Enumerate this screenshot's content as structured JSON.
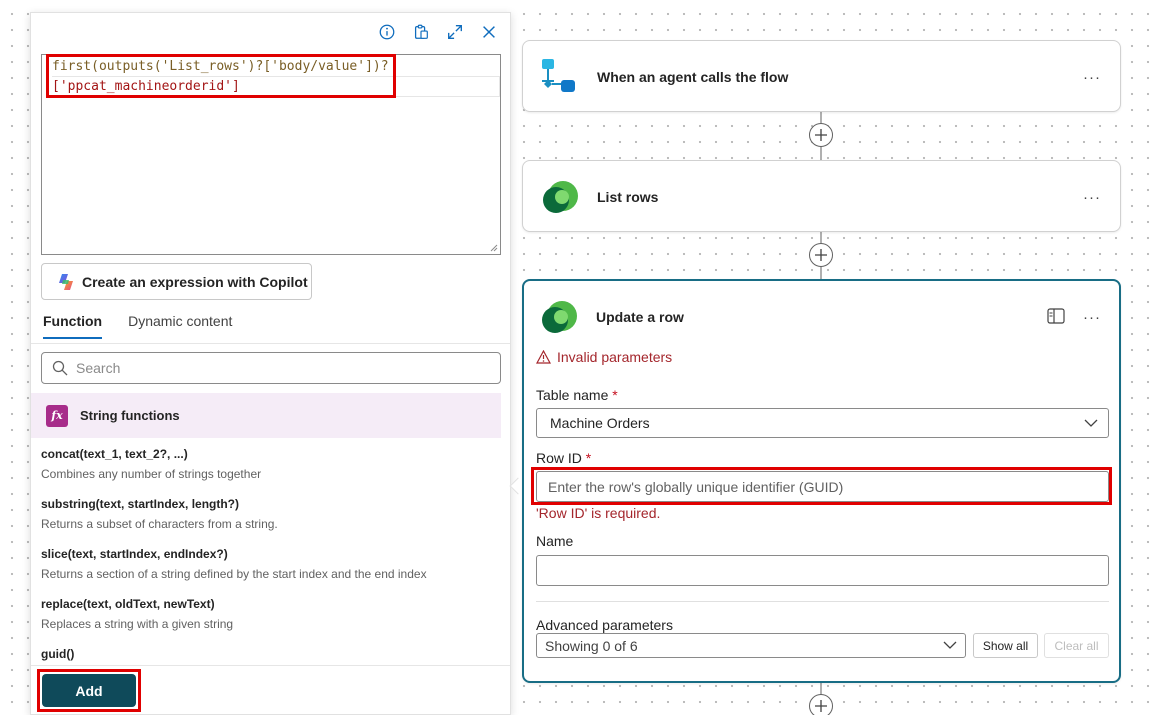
{
  "expression": {
    "line1": "first(outputs('List_rows')?['body/value'])?",
    "line2": "['ppcat_machineorderid']"
  },
  "toolbar": {
    "icons": [
      "info-icon",
      "clipboard-icon",
      "expand-icon",
      "close-icon"
    ]
  },
  "copilot_button": "Create an expression with Copilot",
  "tabs": [
    {
      "label": "Function",
      "active": true
    },
    {
      "label": "Dynamic content",
      "active": false
    }
  ],
  "search": {
    "placeholder": "Search",
    "value": ""
  },
  "function_group": {
    "label": "String functions",
    "icon_text": "fx"
  },
  "functions": [
    {
      "signature": "concat(text_1, text_2?, ...)",
      "description": "Combines any number of strings together"
    },
    {
      "signature": "substring(text, startIndex, length?)",
      "description": "Returns a subset of characters from a string."
    },
    {
      "signature": "slice(text, startIndex, endIndex?)",
      "description": "Returns a section of a string defined by the start index and the end index"
    },
    {
      "signature": "replace(text, oldText, newText)",
      "description": "Replaces a string with a given string"
    },
    {
      "signature": "guid()",
      "description": ""
    }
  ],
  "add_button": "Add",
  "flow": {
    "trigger": {
      "title": "When an agent calls the flow",
      "more": "···"
    },
    "list_rows": {
      "title": "List rows",
      "more": "···"
    },
    "update_row": {
      "title": "Update a row",
      "more": "···",
      "invalid": "Invalid parameters",
      "table_name_label": "Table name",
      "table_name_value": "Machine Orders",
      "row_id_label": "Row ID",
      "row_id_placeholder": "Enter the row's globally unique identifier (GUID)",
      "row_id_error": "'Row ID' is required.",
      "name_label": "Name",
      "name_value": "",
      "advanced_label": "Advanced parameters",
      "advanced_value": "Showing 0 of 6",
      "show_all": "Show all",
      "clear_all": "Clear all",
      "required_mark": "*"
    }
  },
  "colors": {
    "accent": "#186d85",
    "add_button": "#0f4a5a",
    "error": "#a4262c",
    "highlight": "#e00000",
    "group_bg": "#f5ecf7"
  }
}
